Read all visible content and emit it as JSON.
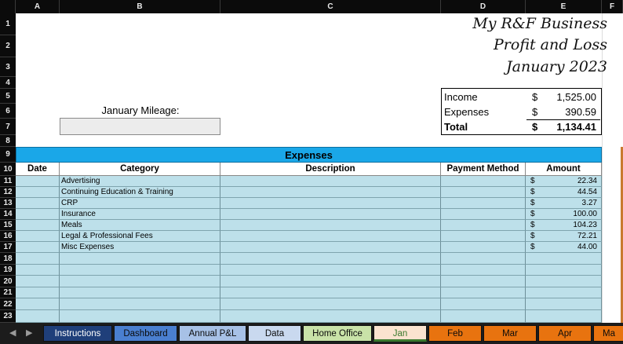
{
  "columns": [
    "A",
    "B",
    "C",
    "D",
    "E",
    "F"
  ],
  "rows": [
    "1",
    "2",
    "3",
    "4",
    "5",
    "6",
    "7",
    "8",
    "9",
    "10",
    "11",
    "12",
    "13",
    "14",
    "15",
    "16",
    "17",
    "18",
    "19",
    "20",
    "21",
    "22",
    "23"
  ],
  "title": {
    "line1": "My R&F Business",
    "line2": "Profit and Loss",
    "line3": "January 2023"
  },
  "mileage": {
    "label": "January Mileage:",
    "value": ""
  },
  "summary": {
    "income_label": "Income",
    "income_currency": "$",
    "income_value": "1,525.00",
    "expenses_label": "Expenses",
    "expenses_currency": "$",
    "expenses_value": "390.59",
    "total_label": "Total",
    "total_currency": "$",
    "total_value": "1,134.41"
  },
  "expenses": {
    "band_title": "Expenses",
    "headers": {
      "date": "Date",
      "category": "Category",
      "description": "Description",
      "payment": "Payment Method",
      "amount": "Amount"
    },
    "rows": [
      {
        "category": "Advertising",
        "currency": "$",
        "amount": "22.34"
      },
      {
        "category": "Continuing Education & Training",
        "currency": "$",
        "amount": "44.54"
      },
      {
        "category": "CRP",
        "currency": "$",
        "amount": "3.27"
      },
      {
        "category": "Insurance",
        "currency": "$",
        "amount": "100.00"
      },
      {
        "category": "Meals",
        "currency": "$",
        "amount": "104.23"
      },
      {
        "category": "Legal & Professional Fees",
        "currency": "$",
        "amount": "72.21"
      },
      {
        "category": "Misc Expenses",
        "currency": "$",
        "amount": "44.00"
      },
      {
        "category": "",
        "currency": "",
        "amount": ""
      },
      {
        "category": "",
        "currency": "",
        "amount": ""
      },
      {
        "category": "",
        "currency": "",
        "amount": ""
      },
      {
        "category": "",
        "currency": "",
        "amount": ""
      },
      {
        "category": "",
        "currency": "",
        "amount": ""
      },
      {
        "category": "",
        "currency": "",
        "amount": ""
      }
    ]
  },
  "tabs": [
    {
      "label": "Instructions",
      "bg": "#1f3f7a",
      "fg": "#ffffff",
      "active": false
    },
    {
      "label": "Dashboard",
      "bg": "#4a7fd0",
      "fg": "#0b0b0b",
      "active": false
    },
    {
      "label": "Annual P&L",
      "bg": "#a7c1e6",
      "fg": "#0b0b0b",
      "active": false
    },
    {
      "label": "Data",
      "bg": "#c9d9ef",
      "fg": "#0b0b0b",
      "active": false
    },
    {
      "label": "Home Office",
      "bg": "#c9e2a8",
      "fg": "#0b0b0b",
      "active": false
    },
    {
      "label": "Jan",
      "bg": "#fbe3cf",
      "fg": "#3b7a2e",
      "active": true
    },
    {
      "label": "Feb",
      "bg": "#e8730f",
      "fg": "#0b0b0b",
      "active": false
    },
    {
      "label": "Mar",
      "bg": "#e8730f",
      "fg": "#0b0b0b",
      "active": false
    },
    {
      "label": "Apr",
      "bg": "#e8730f",
      "fg": "#0b0b0b",
      "active": false
    },
    {
      "label": "Ma",
      "bg": "#e8730f",
      "fg": "#0b0b0b",
      "active": false
    }
  ],
  "colors": {
    "expenses_band": "#1aa7e8",
    "table_fill": "#bde0ea",
    "header_bg": "#0b0b0b"
  }
}
